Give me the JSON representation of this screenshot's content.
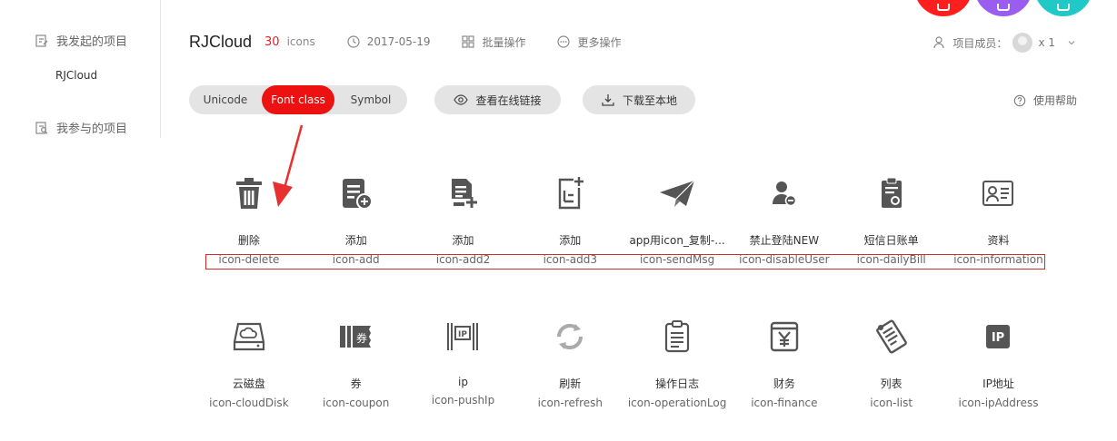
{
  "sidebar": {
    "initiated_label": "我发起的项目",
    "project_item": "RJCloud",
    "joined_label": "我参与的项目"
  },
  "header": {
    "title": "RJCloud",
    "icon_count": "30",
    "icon_count_label": "icons",
    "date": "2017-05-19",
    "batch_label": "批量操作",
    "more_label": "更多操作",
    "members_label": "项目成员：",
    "members_count": "x 1"
  },
  "toolbar": {
    "tabs": [
      "Unicode",
      "Font class",
      "Symbol"
    ],
    "active_tab": "Font class",
    "view_link_label": "查看在线链接",
    "download_label": "下载至本地",
    "help_label": "使用帮助"
  },
  "colors": {
    "accent": "#ee1111",
    "pill_bg": "#e4e4e4",
    "icon_gray": "#555555",
    "highlight_border": "#d62b2b"
  },
  "icons_row1": [
    {
      "name": "删除",
      "class": "icon-delete",
      "icon": "trash-icon"
    },
    {
      "name": "添加",
      "class": "icon-add",
      "icon": "list-add-icon"
    },
    {
      "name": "添加",
      "class": "icon-add2",
      "icon": "doc-add-icon"
    },
    {
      "name": "添加",
      "class": "icon-add3",
      "icon": "doc-add-outline-icon"
    },
    {
      "name": "app用icon_复制-...",
      "class": "icon-sendMsg",
      "icon": "paper-plane-icon"
    },
    {
      "name": "禁止登陆NEW",
      "class": "icon-disableUser",
      "icon": "user-minus-icon"
    },
    {
      "name": "短信日账单",
      "class": "icon-dailyBill",
      "icon": "clipboard-gear-icon"
    },
    {
      "name": "资料",
      "class": "icon-information",
      "icon": "id-card-icon"
    }
  ],
  "icons_row2": [
    {
      "name": "云磁盘",
      "class": "icon-cloudDisk",
      "icon": "cloud-disk-icon"
    },
    {
      "name": "券",
      "class": "icon-coupon",
      "icon": "coupon-icon"
    },
    {
      "name": "ip",
      "class": "icon-pushIp",
      "icon": "ip-box-icon"
    },
    {
      "name": "刷新",
      "class": "icon-refresh",
      "icon": "refresh-icon"
    },
    {
      "name": "操作日志",
      "class": "icon-operationLog",
      "icon": "clipboard-log-icon"
    },
    {
      "name": "财务",
      "class": "icon-finance",
      "icon": "yen-icon"
    },
    {
      "name": "列表",
      "class": "icon-list",
      "icon": "list-sheet-icon"
    },
    {
      "name": "IP地址",
      "class": "icon-ipAddress",
      "icon": "ip-address-icon"
    }
  ]
}
